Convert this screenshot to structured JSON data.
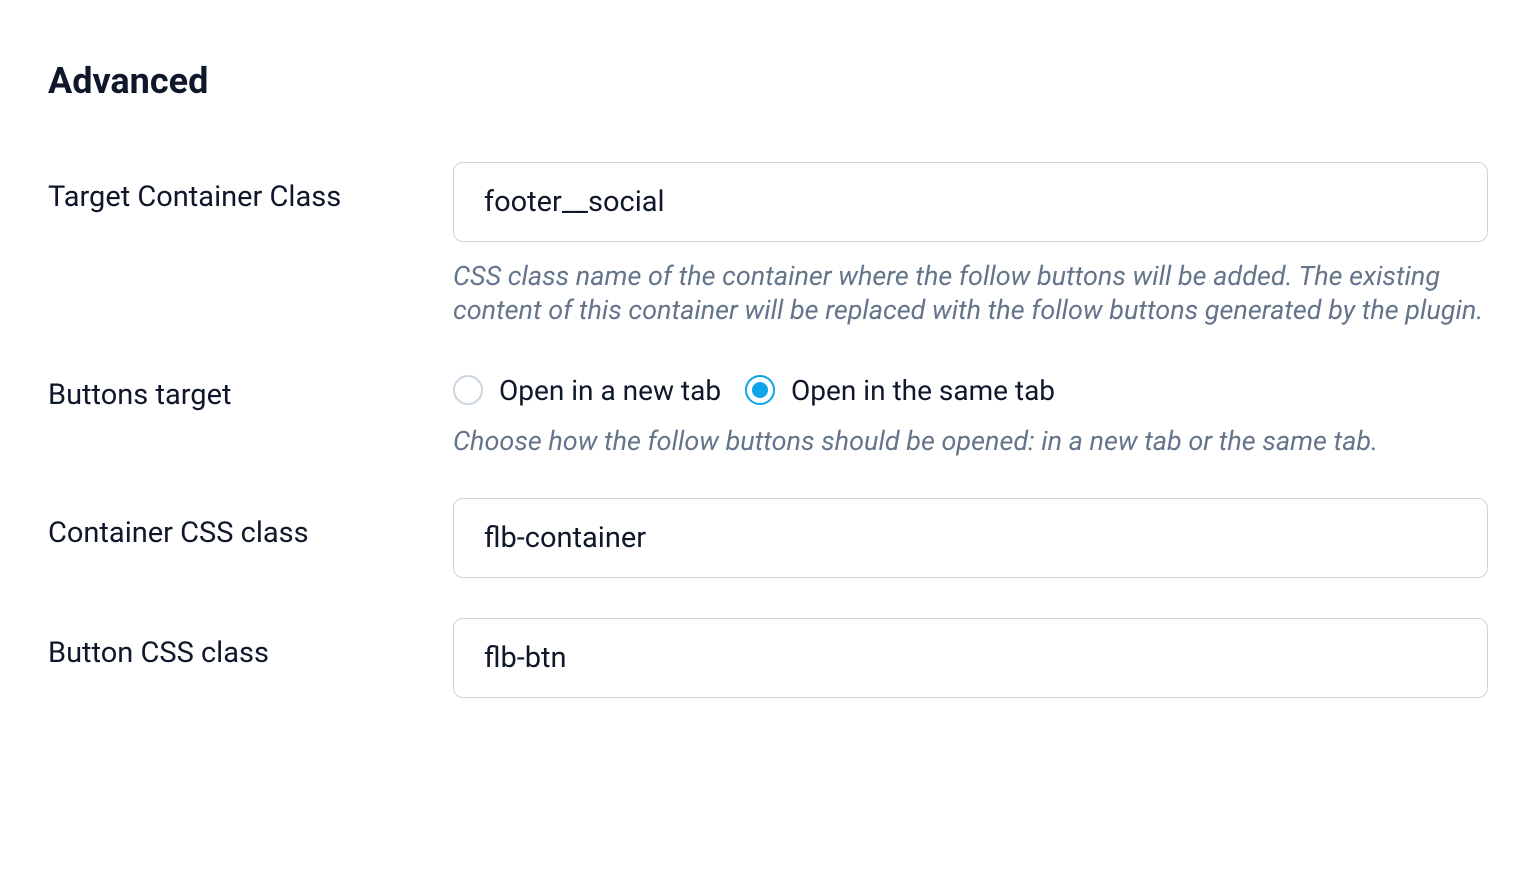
{
  "section": {
    "title": "Advanced"
  },
  "fields": {
    "targetContainer": {
      "label": "Target Container Class",
      "value": "footer__social",
      "help": "CSS class name of the container where the follow buttons will be added. The existing content of this container will be replaced with the follow buttons generated by the plugin."
    },
    "buttonsTarget": {
      "label": "Buttons target",
      "options": {
        "newTab": "Open in a new tab",
        "sameTab": "Open in the same tab"
      },
      "selected": "sameTab",
      "help": "Choose how the follow buttons should be opened: in a new tab or the same tab."
    },
    "containerCssClass": {
      "label": "Container CSS class",
      "value": "flb-container"
    },
    "buttonCssClass": {
      "label": "Button CSS class",
      "value": "flb-btn"
    }
  }
}
